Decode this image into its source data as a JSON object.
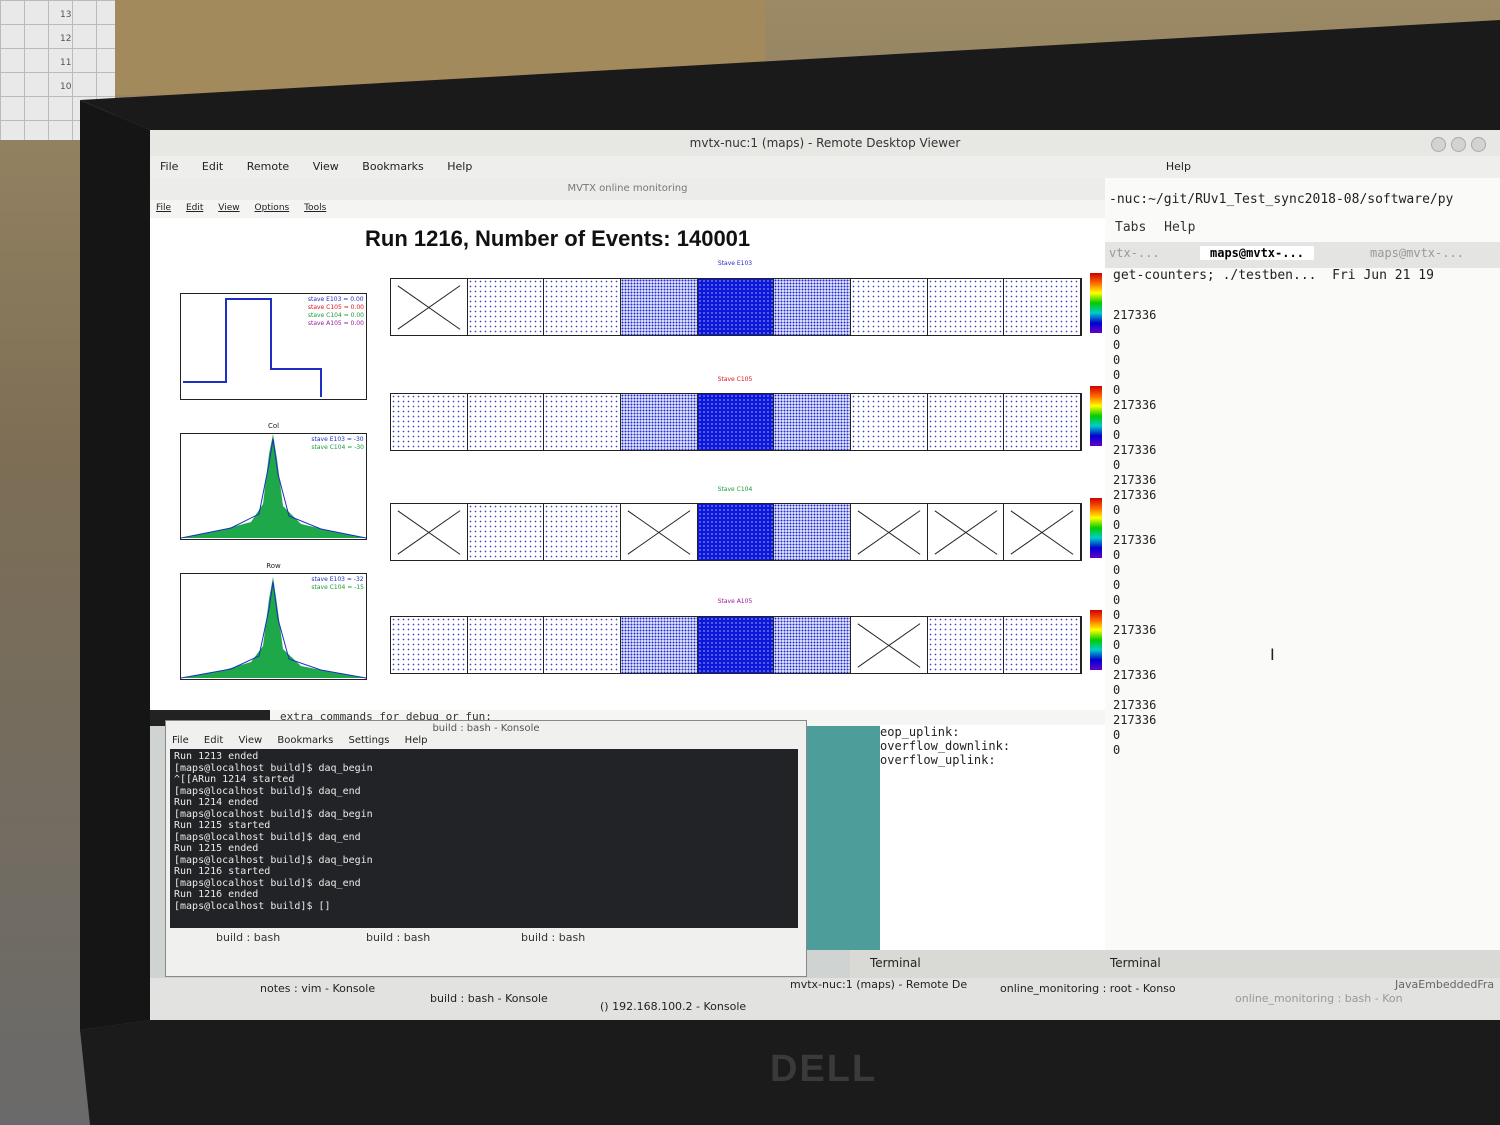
{
  "remote_viewer": {
    "title": "mvtx-nuc:1 (maps) - Remote Desktop Viewer",
    "notes_title": "notes : vim - Konsole",
    "menu": [
      "Remote",
      "View",
      "Bookmarks",
      "Help"
    ],
    "outer_menu": [
      "File",
      "Edit"
    ],
    "help": "Help"
  },
  "monitor": {
    "title": "MVTX online monitoring",
    "menu": [
      "File",
      "Edit",
      "View",
      "Options",
      "Tools"
    ],
    "run_title": "Run 1216, Number of Events: 140001",
    "staves": [
      "Stave E103",
      "Stave C105",
      "Stave C104",
      "Stave A105"
    ],
    "plot_labels": [
      "",
      "Col",
      "Row"
    ],
    "legend1": [
      "stave E103 = 0.00",
      "stave C105 = 0.00",
      "stave C104 = 0.00",
      "stave A105 = 0.00"
    ],
    "legend2": [
      "stave E103 = -30",
      "stave C104 = -30"
    ],
    "legend3": [
      "stave E103 = -32",
      "stave C104 = -15"
    ]
  },
  "right_terminal": {
    "path": "-nuc:~/git/RUv1_Test_sync2018-08/software/py",
    "menu": [
      "Tabs",
      "Help"
    ],
    "tabs": [
      "vtx-...",
      "maps@mvtx-...",
      "maps@mvtx-..."
    ],
    "command": "get-counters; ./testben...",
    "date": "Fri Jun 21 19",
    "values": [
      "217336",
      "0",
      "0",
      "0",
      "0",
      "0",
      "217336",
      "0",
      "0",
      "217336",
      "0",
      "217336",
      "217336",
      "0",
      "0",
      "217336",
      "0",
      "0",
      "0",
      "0",
      "0",
      "217336",
      "0",
      "0",
      "217336",
      "0",
      "217336",
      "217336",
      "0",
      "0"
    ]
  },
  "mid_terminal": {
    "extra": "extra commands for debug or fun:",
    "lines": [
      "eop_uplink:",
      "overflow_downlink:",
      "overflow_uplink:"
    ]
  },
  "konsole": {
    "title": "build : bash - Konsole",
    "menu": [
      "File",
      "Edit",
      "View",
      "Bookmarks",
      "Settings",
      "Help"
    ],
    "lines": [
      "Run 1213 ended",
      "[maps@localhost build]$ daq_begin",
      "^[[ARun 1214 started",
      "[maps@localhost build]$ daq_end",
      "Run 1214 ended",
      "[maps@localhost build]$ daq_begin",
      "Run 1215 started",
      "[maps@localhost build]$ daq_end",
      "Run 1215 ended",
      "[maps@localhost build]$ daq_begin",
      "Run 1216 started",
      "[maps@localhost build]$ daq_end",
      "Run 1216 ended",
      "[maps@localhost build]$ []"
    ],
    "tabs": [
      "build : bash",
      "build : bash",
      "build : bash"
    ]
  },
  "taskbar": {
    "items": [
      "notes : vim - Konsole",
      "build : bash - Konsole",
      "() 192.168.100.2 - Konsole",
      "mvtx-nuc:1 (maps) - Remote De",
      "online_monitoring : root - Konso",
      "online_monitoring : bash - Kon",
      "Terminal",
      "Terminal",
      "JavaEmbeddedFra"
    ]
  },
  "brand": "DELL"
}
